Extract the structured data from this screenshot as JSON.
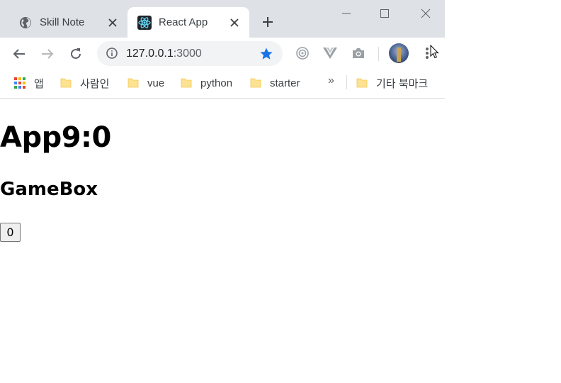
{
  "tabs": [
    {
      "title": "Skill Note",
      "icon": "globe-icon",
      "active": false
    },
    {
      "title": "React App",
      "icon": "react-logo-icon",
      "active": true
    }
  ],
  "address": {
    "host": "127.0.0.1",
    "port": ":3000"
  },
  "bookmarks": [
    {
      "label": "앱",
      "icon": "apps-grid-icon"
    },
    {
      "label": "사람인",
      "icon": "folder-icon"
    },
    {
      "label": "vue",
      "icon": "folder-icon"
    },
    {
      "label": "python",
      "icon": "folder-icon"
    },
    {
      "label": "starter",
      "icon": "folder-icon"
    }
  ],
  "bookmarks_overflow": "»",
  "other_bookmarks": "기타 북마크",
  "page": {
    "heading": "App9:0",
    "subheading": "GameBox",
    "button_label": "0"
  },
  "colors": {
    "tabstrip": "#dee1e6",
    "omnibox": "#f1f3f4",
    "star": "#1a73e8",
    "icon_gray": "#5f6368",
    "folder": "#fde293"
  }
}
